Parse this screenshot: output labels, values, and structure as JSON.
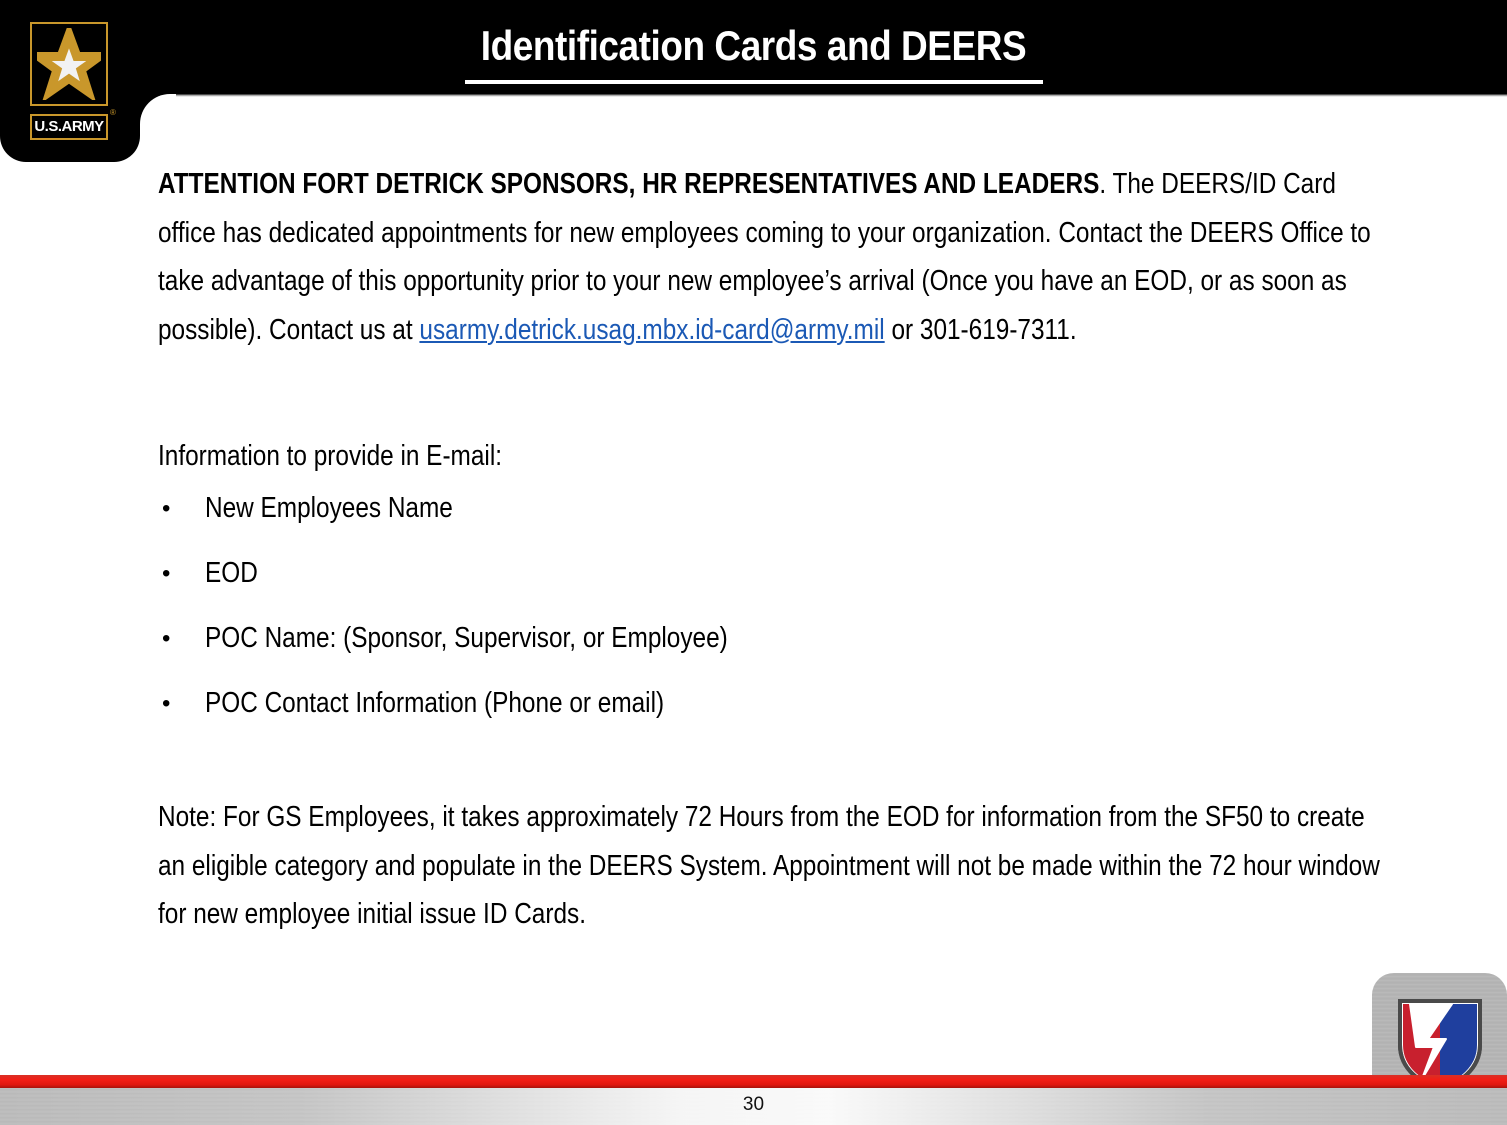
{
  "header": {
    "title": "Identification Cards and DEERS",
    "logo_wordmark": "U.S.ARMY",
    "logo_registered": "®",
    "star_icon": "army-star-icon"
  },
  "body": {
    "paragraph1": {
      "bold_lead": "ATTENTION FORT DETRICK SPONSORS, HR REPRESENTATIVES AND LEADERS",
      "text_before_link": ". The DEERS/ID Card office has dedicated appointments for new employees coming to your organization. Contact the DEERS Office to take advantage of this opportunity prior to your new employee’s arrival (Once you have an EOD, or as soon as possible). Contact us at ",
      "email_link": "usarmy.detrick.usag.mbx.id-card@army.mil",
      "text_after_link": " or 301-619-7311.",
      "phone": "301-619-7311"
    },
    "lead_in": "Information to provide in E-mail:",
    "bullet_marker": "•",
    "bullets": [
      "New Employees Name",
      "EOD",
      "POC Name: (Sponsor, Supervisor, or Employee)",
      "POC Contact Information (Phone or email)"
    ],
    "note": "Note: For GS Employees, it takes approximately 72 Hours from the EOD for information from the SF50 to create an eligible category and populate in the DEERS System. Appointment will not be made within the 72 hour window for new employee initial issue ID Cards."
  },
  "footer": {
    "page_number": "30",
    "shield_icon": "imcom-shield-icon"
  },
  "colors": {
    "header_background": "#000000",
    "title_text": "#ffffff",
    "link": "#1b59b5",
    "footer_red": "#e0170f",
    "logo_gold": "#c9972b",
    "shield_red": "#c8202e",
    "shield_blue": "#1f3f9e"
  }
}
